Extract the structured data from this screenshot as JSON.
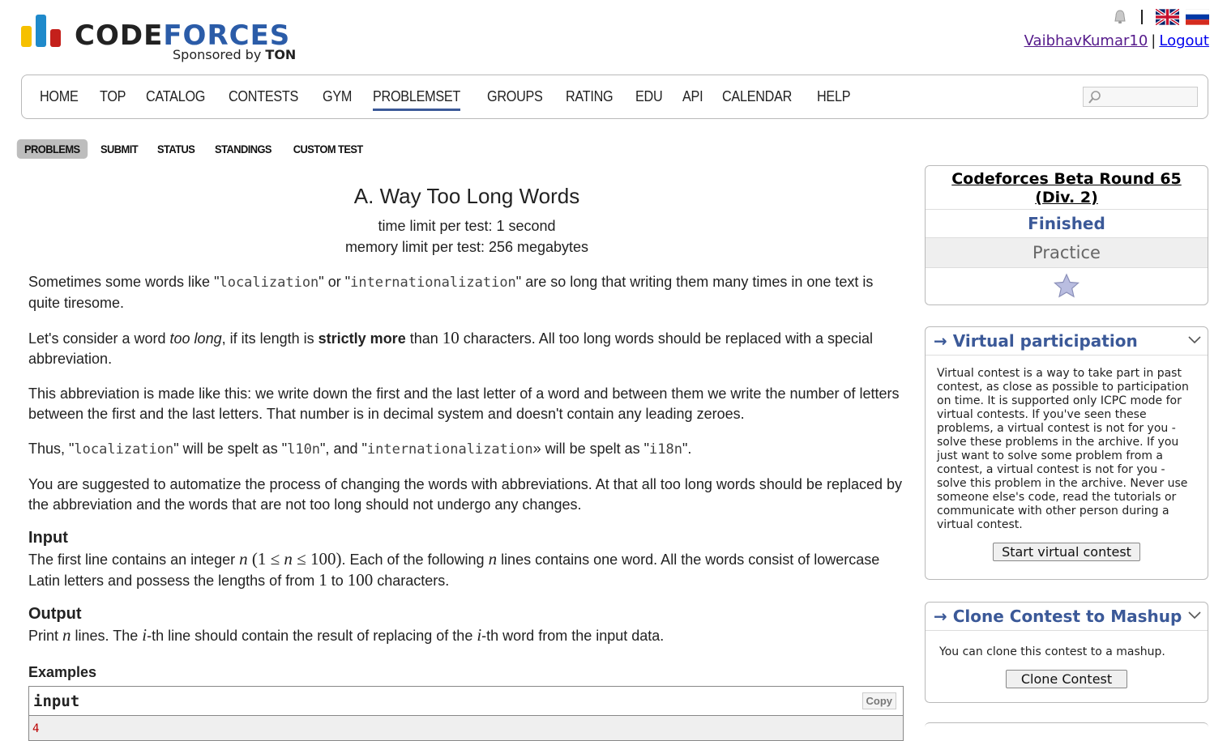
{
  "header": {
    "logo_word_code": "CODE",
    "logo_word_forces": "FORCES",
    "logo_sponsor_prefix": "Sponsored by",
    "logo_sponsor_name": "TON",
    "username": "VaibhavKumar10",
    "logout_label": "Logout",
    "separator": "|"
  },
  "main_menu": {
    "items": [
      "HOME",
      "TOP",
      "CATALOG",
      "CONTESTS",
      "GYM",
      "PROBLEMSET",
      "GROUPS",
      "RATING",
      "EDU",
      "API",
      "CALENDAR",
      "HELP"
    ],
    "active": "PROBLEMSET",
    "search_value": ""
  },
  "sub_menu": {
    "items": [
      "PROBLEMS",
      "SUBMIT",
      "STATUS",
      "STANDINGS",
      "CUSTOM TEST"
    ],
    "active": "PROBLEMS"
  },
  "problem": {
    "title": "A. Way Too Long Words",
    "time_limit": "time limit per test: 1 second",
    "memory_limit": "memory limit per test: 256 megabytes",
    "p1": {
      "a": "Sometimes some words like \"",
      "code1": "localization",
      "b": "\" or \"",
      "code2": "internationalization",
      "c": "\" are so long that writing them many times in one text is quite tiresome."
    },
    "p2": {
      "a": "Let's consider a word ",
      "em": "too long",
      "b": ", if its length is ",
      "strong": "strictly more",
      "c": " than ",
      "num": "10",
      "d": " characters. All too long words should be replaced with a special abbreviation."
    },
    "p3": "This abbreviation is made like this: we write down the first and the last letter of a word and between them we write the number of letters between the first and the last letters. That number is in decimal system and doesn't contain any leading zeroes.",
    "p4": {
      "a": "Thus, \"",
      "code1": "localization",
      "b": "\" will be spelt as \"",
      "code2": "l10n",
      "c": "\", and \"",
      "code3": "internationalization",
      "d": "» will be spelt as \"",
      "code4": "i18n",
      "e": "\"."
    },
    "p5": "You are suggested to automatize the process of changing the words with abbreviations. At that all too long words should be replaced by the abbreviation and the words that are not too long should not undergo any changes.",
    "input_title": "Input",
    "input": {
      "a": "The first line contains an integer ",
      "n": "n",
      "range_open": " (1 ≤ ",
      "range_close": " ≤ 100)",
      "b": ". Each of the following ",
      "c": " lines contains one word. All the words consist of lowercase Latin letters and possess the lengths of from ",
      "one": "1",
      "d": " to ",
      "hundred": "100",
      "e": " characters."
    },
    "output_title": "Output",
    "output": {
      "a": "Print ",
      "n": "n",
      "b": " lines. The ",
      "i": "i",
      "c": "-th line should contain the result of replacing of the ",
      "d": "-th word from the input data."
    },
    "examples_title": "Examples",
    "sample_input_label": "input",
    "copy_label": "Copy",
    "sample_input_first_line": "4"
  },
  "sidebar": {
    "contest_name": "Codeforces Beta Round 65 (Div. 2)",
    "status": "Finished",
    "practice": "Practice",
    "virtual_title": "→ Virtual participation",
    "virtual_text": "Virtual contest is a way to take part in past contest, as close as possible to participation on time. It is supported only ICPC mode for virtual contests. If you've seen these problems, a virtual contest is not for you - solve these problems in the archive. If you just want to solve some problem from a contest, a virtual contest is not for you - solve this problem in the archive. Never use someone else's code, read the tutorials or communicate with other person during a virtual contest.",
    "virtual_button": "Start virtual contest",
    "clone_title": "→ Clone Contest to Mashup",
    "clone_text": "You can clone this contest to a mashup.",
    "clone_button": "Clone Contest"
  },
  "colors": {
    "brand_blue": "#2b5ca8",
    "caption_blue": "#3b5998",
    "logo_yellow": "#f6c000",
    "logo_blue": "#1f8acb",
    "logo_red": "#c4201b"
  },
  "icons": [
    "codeforces-logo-bars",
    "bell-icon",
    "uk-flag-icon",
    "russia-flag-icon",
    "search-icon",
    "star-icon",
    "chevron-down-icon"
  ]
}
